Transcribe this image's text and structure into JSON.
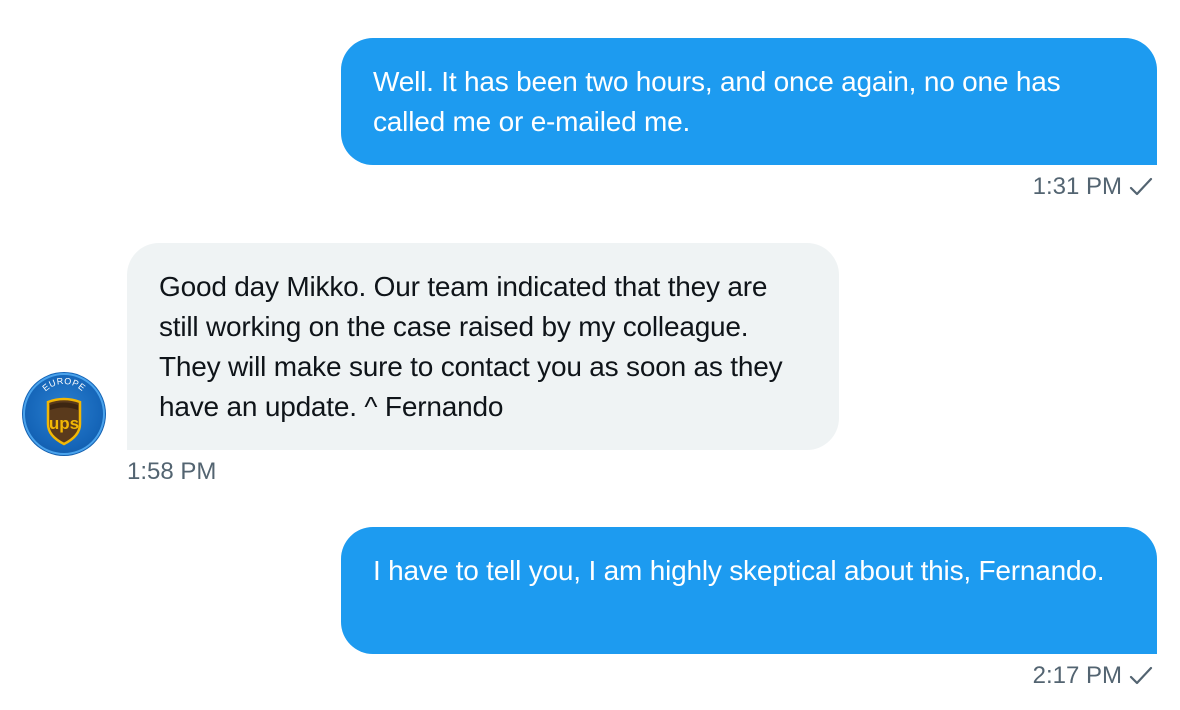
{
  "messages": [
    {
      "direction": "outgoing",
      "text": "Well. It has been two hours, and once again, no one has called me or e-mailed me.",
      "time": "1:31 PM",
      "status_icon": "check-icon"
    },
    {
      "direction": "incoming",
      "text": "Good day Mikko. Our team indicated that they are still working on the case raised by my colleague. They will make sure to contact you as soon as they have an update. ^ Fernando",
      "time": "1:58 PM",
      "avatar": {
        "icon": "ups-europe-logo",
        "label_top": "EUROPE",
        "label_main": "ups"
      }
    },
    {
      "direction": "outgoing",
      "text": "I have to tell you, I am highly skeptical about this, Fernando.",
      "time": "2:17 PM",
      "status_icon": "check-icon"
    }
  ],
  "colors": {
    "outgoing_bubble": "#1d9bf0",
    "incoming_bubble": "#eff3f4",
    "meta_text": "#536471",
    "incoming_text": "#0f1419"
  }
}
